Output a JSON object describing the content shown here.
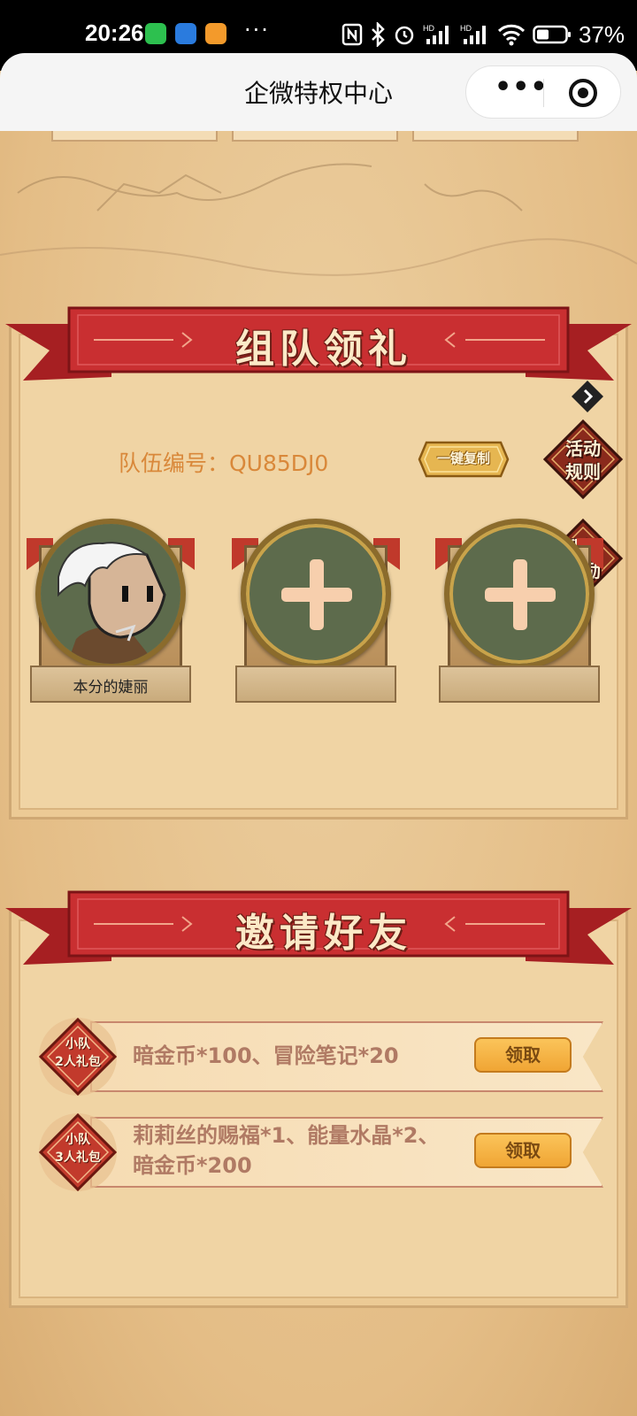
{
  "status_bar": {
    "time": "20:26",
    "more": "···",
    "battery": "37%",
    "icons": [
      "wechat-icon",
      "qq-icon",
      "video-app-icon",
      "nfc-icon",
      "bluetooth-icon",
      "alarm-icon",
      "hd-signal-icon",
      "hd-signal-icon",
      "wifi-icon",
      "battery-icon"
    ]
  },
  "title_bar": {
    "title": "企微特权中心",
    "more_icon": "•••",
    "close_icon": "target-icon"
  },
  "team_section": {
    "title": "组队领礼",
    "team_id_label": "队伍编号：QU85DJ0",
    "copy_label": "一键复制",
    "rules_label": [
      "活动",
      "规则"
    ],
    "rewards_label": [
      "我的",
      "奖励"
    ],
    "members": [
      {
        "name": "本分的婕丽",
        "filled": true
      },
      {
        "name": "",
        "filled": false
      },
      {
        "name": "",
        "filled": false
      }
    ]
  },
  "invite_section": {
    "title": "邀请好友",
    "rewards": [
      {
        "badge": [
          "小队",
          "2人礼包"
        ],
        "lines": [
          "暗金币*100、冒险笔记*20"
        ],
        "button": "领取"
      },
      {
        "badge": [
          "小队",
          "3人礼包"
        ],
        "lines": [
          "莉莉丝的赐福*1、能量水晶*2、",
          "暗金币*200"
        ],
        "button": "领取"
      }
    ]
  },
  "colors": {
    "ribbon_red": "#c92f31",
    "panel": "#f0d4a4",
    "accent_orange": "#d9883a",
    "claim_yellow": "#f0a534"
  }
}
